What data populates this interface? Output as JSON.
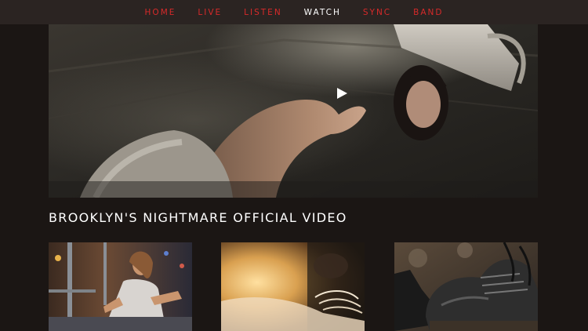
{
  "nav": {
    "items": [
      {
        "label": "HOME",
        "active": false
      },
      {
        "label": "LIVE",
        "active": false
      },
      {
        "label": "LISTEN",
        "active": false
      },
      {
        "label": "WATCH",
        "active": true
      },
      {
        "label": "SYNC",
        "active": false
      },
      {
        "label": "BAND",
        "active": false
      }
    ]
  },
  "player": {
    "play_icon": "play-icon"
  },
  "video": {
    "title": "BROOKLYN'S NIGHTMARE OFFICIAL VIDEO"
  },
  "colors": {
    "accent": "#d72a2a",
    "active_nav": "#ffffff",
    "background": "#1b1614",
    "nav_background": "#2b2422"
  }
}
